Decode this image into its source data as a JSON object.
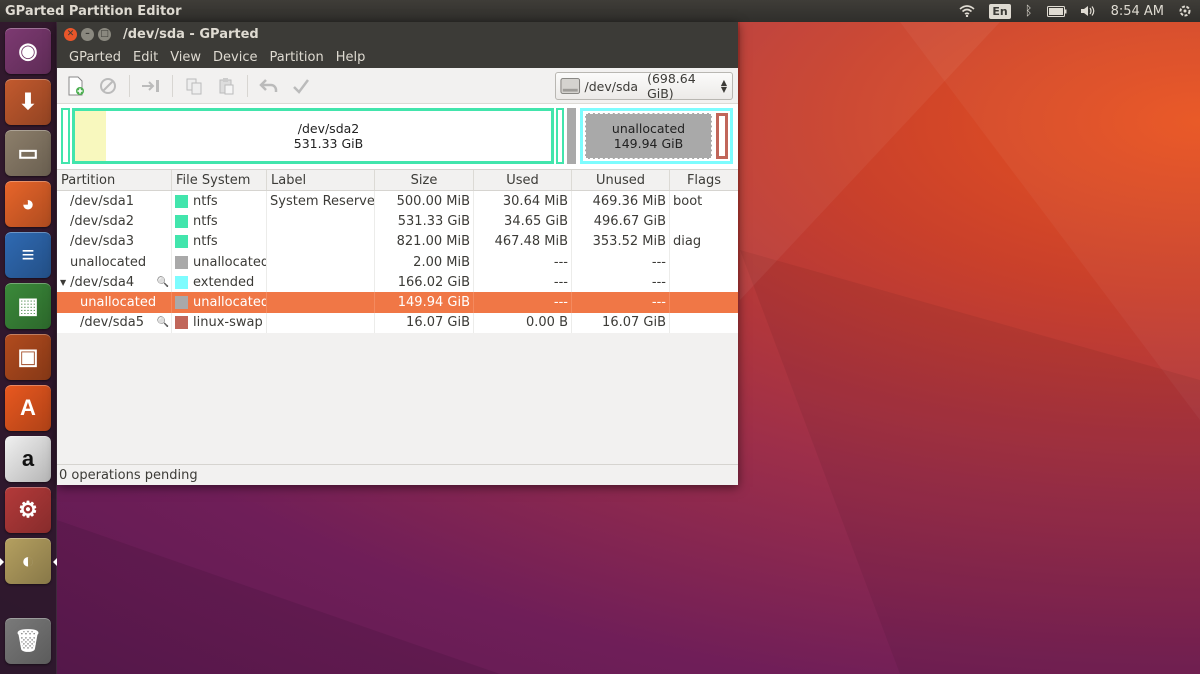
{
  "top_panel": {
    "title": "GParted Partition Editor",
    "keyboard": "En",
    "time": "8:54 AM"
  },
  "launcher": [
    {
      "name": "ubuntu-dash",
      "glyph": "◉",
      "color": "#7d3a72"
    },
    {
      "name": "installer",
      "glyph": "⬇",
      "color": "#c35a2e"
    },
    {
      "name": "files",
      "glyph": "▭",
      "color": "#8d7f6b"
    },
    {
      "name": "firefox",
      "glyph": "◕",
      "color": "#e8652a"
    },
    {
      "name": "writer",
      "glyph": "≡",
      "color": "#2f6ab3"
    },
    {
      "name": "calc",
      "glyph": "▦",
      "color": "#3b8a3a"
    },
    {
      "name": "impress",
      "glyph": "▣",
      "color": "#b24b1e"
    },
    {
      "name": "software",
      "glyph": "A",
      "color": "#e9581f"
    },
    {
      "name": "amazon",
      "glyph": "a",
      "color": "#f1f1f1"
    },
    {
      "name": "settings",
      "glyph": "⚙",
      "color": "#b43a3a"
    },
    {
      "name": "gparted",
      "glyph": "◐",
      "color": "#b5a060"
    },
    {
      "name": "trash",
      "glyph": "🗑",
      "color": "#7a7a7a"
    }
  ],
  "window": {
    "title": "/dev/sda - GParted",
    "menus": [
      "GParted",
      "Edit",
      "View",
      "Device",
      "Partition",
      "Help"
    ],
    "device": "/dev/sda",
    "device_size": "(698.64 GiB)",
    "map": {
      "sda2_name": "/dev/sda2",
      "sda2_size": "531.33 GiB",
      "unalloc_name": "unallocated",
      "unalloc_size": "149.94 GiB"
    },
    "columns": [
      "Partition",
      "File System",
      "Label",
      "Size",
      "Used",
      "Unused",
      "Flags"
    ],
    "rows": [
      {
        "partition": "/dev/sda1",
        "fs": "ntfs",
        "fscolor": "#42e5ac",
        "label": "System Reserved",
        "size": "500.00 MiB",
        "used": "30.64 MiB",
        "unused": "469.36 MiB",
        "flags": "boot",
        "indent": 0
      },
      {
        "partition": "/dev/sda2",
        "fs": "ntfs",
        "fscolor": "#42e5ac",
        "label": "",
        "size": "531.33 GiB",
        "used": "34.65 GiB",
        "unused": "496.67 GiB",
        "flags": "",
        "indent": 0
      },
      {
        "partition": "/dev/sda3",
        "fs": "ntfs",
        "fscolor": "#42e5ac",
        "label": "",
        "size": "821.00 MiB",
        "used": "467.48 MiB",
        "unused": "353.52 MiB",
        "flags": "diag",
        "indent": 0
      },
      {
        "partition": "unallocated",
        "fs": "unallocated",
        "fscolor": "#a9a9a9",
        "label": "",
        "size": "2.00 MiB",
        "used": "---",
        "unused": "---",
        "flags": "",
        "indent": 0
      },
      {
        "partition": "/dev/sda4",
        "fs": "extended",
        "fscolor": "#7dfcfe",
        "label": "",
        "size": "166.02 GiB",
        "used": "---",
        "unused": "---",
        "flags": "",
        "indent": 0,
        "expander": true,
        "key": true
      },
      {
        "partition": "unallocated",
        "fs": "unallocated",
        "fscolor": "#a9a9a9",
        "label": "",
        "size": "149.94 GiB",
        "used": "---",
        "unused": "---",
        "flags": "",
        "indent": 1,
        "selected": true
      },
      {
        "partition": "/dev/sda5",
        "fs": "linux-swap",
        "fscolor": "#c1665a",
        "label": "",
        "size": "16.07 GiB",
        "used": "0.00 B",
        "unused": "16.07 GiB",
        "flags": "",
        "indent": 1,
        "key": true
      }
    ],
    "status": "0 operations pending"
  }
}
